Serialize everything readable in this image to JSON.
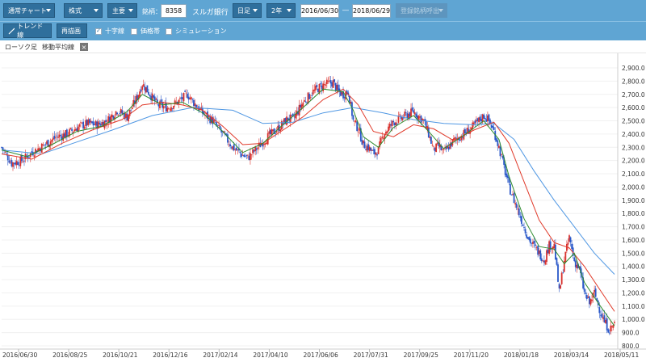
{
  "toolbar": {
    "chart_type": "通常チャート",
    "asset_class": "株式",
    "index_group": "主要",
    "code_label": "銘柄：",
    "code_value": "8358",
    "company_name": "スルガ銀行",
    "period_unit": "日足",
    "span": "2年",
    "date_from": "2016/06/30",
    "date_sep": "―",
    "date_to": "2018/06/29",
    "registered_placeholder": "登録銘柄呼出"
  },
  "toolbar2": {
    "trend_line": "トレンド線",
    "redraw": "再描画",
    "crosshair": "十字線",
    "price_band": "価格帯",
    "simulation": "シミュレーション"
  },
  "legend": {
    "candles": "ローソク足",
    "moving_average": "移動平均線",
    "close_mark": "×"
  },
  "colors": {
    "toolbar_bg": "#5fa5d3",
    "button_bg": "#2f6f9c",
    "up_candle": "#d9322e",
    "down_candle": "#2a58c9",
    "ma_short": "#2e8b2e",
    "ma_mid": "#e03a2a",
    "ma_long": "#4f97e3"
  },
  "chart_data": {
    "type": "line",
    "x_ticks": [
      "2016/06/30",
      "2016/08/25",
      "2016/10/21",
      "2016/12/16",
      "2017/02/14",
      "2017/04/10",
      "2017/06/06",
      "2017/07/31",
      "2017/09/25",
      "2017/11/20",
      "2018/01/18",
      "2018/03/14",
      "2018/05/11"
    ],
    "y_ticks": [
      "800.0",
      "900.0",
      "1,000.0",
      "1,100.0",
      "1,200.0",
      "1,300.0",
      "1,400.0",
      "1,500.0",
      "1,600.0",
      "1,700.0",
      "1,800.0",
      "1,900.0",
      "2,000.0",
      "2,100.0",
      "2,200.0",
      "2,300.0",
      "2,400.0",
      "2,500.0",
      "2,600.0",
      "2,700.0",
      "2,800.0",
      "2,900.0"
    ],
    "ylim": [
      800,
      2900
    ],
    "price_path": [
      [
        0,
        2300
      ],
      [
        2,
        2180
      ],
      [
        4,
        2200
      ],
      [
        6,
        2260
      ],
      [
        9,
        2330
      ],
      [
        11,
        2380
      ],
      [
        13,
        2400
      ],
      [
        15,
        2450
      ],
      [
        17,
        2480
      ],
      [
        19,
        2470
      ],
      [
        21,
        2500
      ],
      [
        23,
        2580
      ],
      [
        25,
        2530
      ],
      [
        27,
        2680
      ],
      [
        28,
        2780
      ],
      [
        29,
        2730
      ],
      [
        31,
        2620
      ],
      [
        33,
        2600
      ],
      [
        35,
        2640
      ],
      [
        37,
        2700
      ],
      [
        38,
        2650
      ],
      [
        40,
        2560
      ],
      [
        42,
        2500
      ],
      [
        44,
        2400
      ],
      [
        46,
        2300
      ],
      [
        48,
        2240
      ],
      [
        49,
        2220
      ],
      [
        51,
        2300
      ],
      [
        53,
        2380
      ],
      [
        55,
        2440
      ],
      [
        57,
        2520
      ],
      [
        58,
        2510
      ],
      [
        60,
        2640
      ],
      [
        62,
        2720
      ],
      [
        64,
        2770
      ],
      [
        66,
        2790
      ],
      [
        67,
        2720
      ],
      [
        68,
        2700
      ],
      [
        69,
        2720
      ],
      [
        70,
        2500
      ],
      [
        71,
        2440
      ],
      [
        72,
        2320
      ],
      [
        73,
        2300
      ],
      [
        74,
        2250
      ],
      [
        75,
        2280
      ],
      [
        76,
        2400
      ],
      [
        78,
        2490
      ],
      [
        80,
        2530
      ],
      [
        82,
        2570
      ],
      [
        84,
        2500
      ],
      [
        85,
        2400
      ],
      [
        86,
        2280
      ],
      [
        87,
        2310
      ],
      [
        88,
        2260
      ],
      [
        90,
        2350
      ],
      [
        92,
        2400
      ],
      [
        94,
        2460
      ],
      [
        96,
        2540
      ],
      [
        97,
        2500
      ],
      [
        98,
        2420
      ],
      [
        99,
        2300
      ],
      [
        100,
        2150
      ],
      [
        101,
        2000
      ],
      [
        102,
        1900
      ],
      [
        103,
        1800
      ],
      [
        104,
        1700
      ],
      [
        105,
        1600
      ],
      [
        106,
        1550
      ],
      [
        107,
        1500
      ],
      [
        108,
        1450
      ],
      [
        109,
        1560
      ],
      [
        110,
        1560
      ],
      [
        111,
        1200
      ],
      [
        112,
        1450
      ],
      [
        113,
        1620
      ],
      [
        114,
        1440
      ],
      [
        115,
        1380
      ],
      [
        116,
        1200
      ],
      [
        117,
        1120
      ],
      [
        118,
        1200
      ],
      [
        119,
        1080
      ],
      [
        120,
        980
      ],
      [
        121,
        920
      ],
      [
        122,
        970
      ]
    ],
    "ma_short": [
      [
        0,
        2280
      ],
      [
        5,
        2230
      ],
      [
        10,
        2320
      ],
      [
        15,
        2420
      ],
      [
        20,
        2460
      ],
      [
        25,
        2570
      ],
      [
        28,
        2700
      ],
      [
        32,
        2620
      ],
      [
        36,
        2640
      ],
      [
        40,
        2560
      ],
      [
        44,
        2420
      ],
      [
        48,
        2260
      ],
      [
        52,
        2330
      ],
      [
        56,
        2470
      ],
      [
        60,
        2600
      ],
      [
        64,
        2740
      ],
      [
        68,
        2720
      ],
      [
        70,
        2580
      ],
      [
        72,
        2380
      ],
      [
        75,
        2300
      ],
      [
        78,
        2450
      ],
      [
        82,
        2540
      ],
      [
        85,
        2420
      ],
      [
        88,
        2290
      ],
      [
        92,
        2390
      ],
      [
        96,
        2500
      ],
      [
        99,
        2360
      ],
      [
        101,
        2080
      ],
      [
        104,
        1760
      ],
      [
        107,
        1550
      ],
      [
        110,
        1530
      ],
      [
        112,
        1420
      ],
      [
        114,
        1500
      ],
      [
        116,
        1280
      ],
      [
        119,
        1110
      ],
      [
        122,
        950
      ]
    ],
    "ma_mid": [
      [
        0,
        2250
      ],
      [
        6,
        2210
      ],
      [
        12,
        2330
      ],
      [
        18,
        2430
      ],
      [
        24,
        2510
      ],
      [
        28,
        2620
      ],
      [
        32,
        2640
      ],
      [
        36,
        2620
      ],
      [
        40,
        2580
      ],
      [
        44,
        2460
      ],
      [
        48,
        2320
      ],
      [
        52,
        2330
      ],
      [
        56,
        2430
      ],
      [
        60,
        2530
      ],
      [
        64,
        2660
      ],
      [
        68,
        2740
      ],
      [
        71,
        2620
      ],
      [
        74,
        2420
      ],
      [
        78,
        2380
      ],
      [
        82,
        2470
      ],
      [
        86,
        2440
      ],
      [
        90,
        2350
      ],
      [
        94,
        2430
      ],
      [
        98,
        2490
      ],
      [
        101,
        2330
      ],
      [
        104,
        2040
      ],
      [
        107,
        1750
      ],
      [
        110,
        1580
      ],
      [
        113,
        1540
      ],
      [
        116,
        1400
      ],
      [
        119,
        1230
      ],
      [
        122,
        1060
      ]
    ],
    "ma_long": [
      [
        0,
        2280
      ],
      [
        8,
        2250
      ],
      [
        15,
        2340
      ],
      [
        22,
        2430
      ],
      [
        30,
        2540
      ],
      [
        38,
        2600
      ],
      [
        46,
        2580
      ],
      [
        52,
        2480
      ],
      [
        58,
        2490
      ],
      [
        64,
        2560
      ],
      [
        70,
        2600
      ],
      [
        76,
        2560
      ],
      [
        82,
        2510
      ],
      [
        88,
        2480
      ],
      [
        94,
        2470
      ],
      [
        98,
        2480
      ],
      [
        102,
        2360
      ],
      [
        106,
        2120
      ],
      [
        110,
        1900
      ],
      [
        114,
        1700
      ],
      [
        118,
        1500
      ],
      [
        122,
        1340
      ]
    ],
    "x_span": [
      0,
      122
    ]
  }
}
